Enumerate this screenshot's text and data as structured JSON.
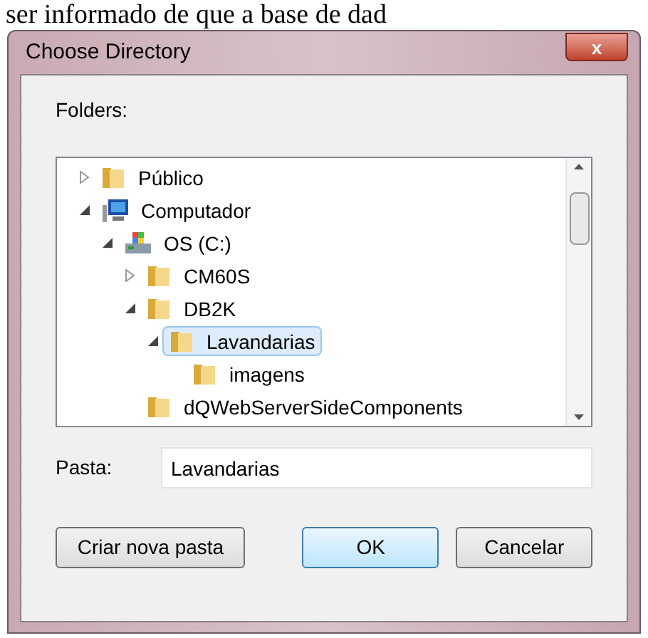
{
  "background_text": "ser informado de que a base de dad",
  "window": {
    "title": "Choose Directory",
    "close_label": "x"
  },
  "folders_label": "Folders:",
  "tree": [
    {
      "label": "Público",
      "kind": "folder",
      "expanded": false,
      "selected": false
    },
    {
      "label": "Computador",
      "kind": "computer",
      "expanded": true,
      "selected": false,
      "children": [
        {
          "label": "OS (C:)",
          "kind": "drive",
          "expanded": true,
          "selected": false,
          "children": [
            {
              "label": "CM60S",
              "kind": "folder",
              "expanded": false,
              "selected": false
            },
            {
              "label": "DB2K",
              "kind": "folder",
              "expanded": true,
              "selected": false,
              "children": [
                {
                  "label": "Lavandarias",
                  "kind": "folder",
                  "expanded": true,
                  "selected": true,
                  "children": [
                    {
                      "label": "imagens",
                      "kind": "folder",
                      "selected": false
                    }
                  ]
                }
              ]
            },
            {
              "label": "dQWebServerSideComponents",
              "kind": "folder",
              "selected": false
            }
          ]
        }
      ]
    }
  ],
  "path_field": {
    "label": "Pasta:",
    "value": "Lavandarias"
  },
  "buttons": [
    {
      "label": "Criar nova pasta",
      "default": false
    },
    {
      "label": "OK",
      "default": true
    },
    {
      "label": "Cancelar",
      "default": false
    }
  ]
}
